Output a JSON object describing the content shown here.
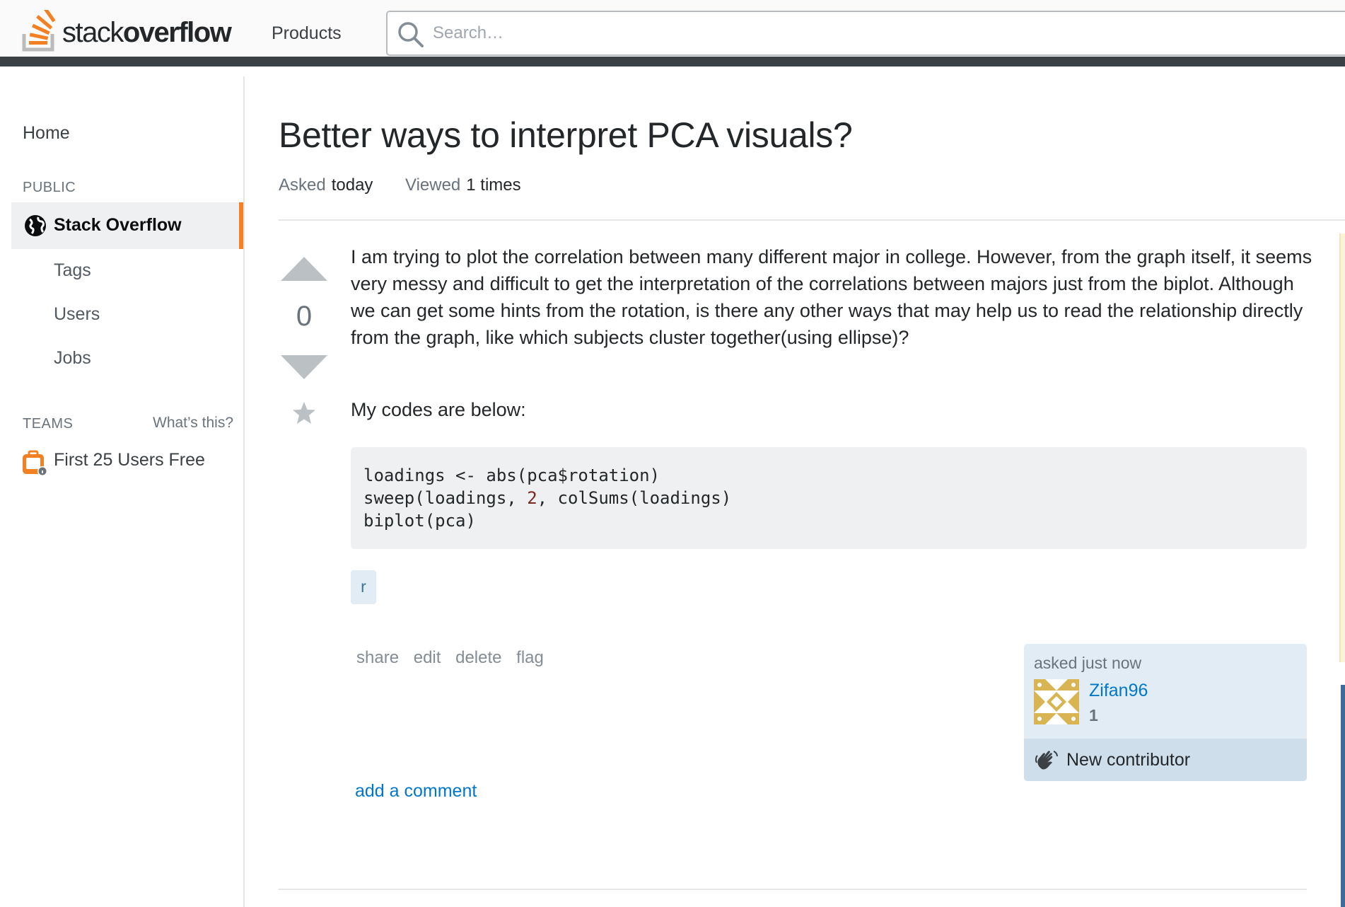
{
  "header": {
    "logo_text_light": "stack",
    "logo_text_bold": "overflow",
    "products_label": "Products",
    "search_placeholder": "Search…",
    "brand_color": "#f48024"
  },
  "sidebar": {
    "home_label": "Home",
    "public_heading": "PUBLIC",
    "active_item_label": "Stack Overflow",
    "sub_items": [
      {
        "label": "Tags"
      },
      {
        "label": "Users"
      },
      {
        "label": "Jobs"
      }
    ],
    "teams_heading": "TEAMS",
    "whats_this_label": "What’s this?",
    "teams_item_label": "First 25 Users Free"
  },
  "question": {
    "title": "Better ways to interpret PCA visuals?",
    "asked_key": "Asked",
    "asked_value": "today",
    "viewed_key": "Viewed",
    "viewed_value": "1 times",
    "vote_count": "0",
    "body_paragraph_1": "I am trying to plot the correlation between many different major in college. However, from the graph itself, it seems very messy and difficult to get the interpretation of the correlations between majors just from the biplot. Although we can get some hints from the rotation, is there any other ways that may help us to read the relationship directly from the graph, like which subjects cluster together(using ellipse)?",
    "body_paragraph_2": "My codes are below:",
    "code_line_1": "loadings <- abs(pca$rotation)",
    "code_line_2_prefix": "sweep(loadings, ",
    "code_line_2_number": "2",
    "code_line_2_suffix": ", colSums(loadings)",
    "code_line_3": "biplot(pca)",
    "tags": [
      {
        "label": "r"
      }
    ],
    "actions": {
      "share": "share",
      "edit": "edit",
      "delete": "delete",
      "flag": "flag"
    },
    "owner": {
      "asked_label": "asked just now",
      "name": "Zifan96",
      "reputation": "1",
      "badge_label": "New contributor"
    },
    "add_comment_label": "add a comment"
  }
}
